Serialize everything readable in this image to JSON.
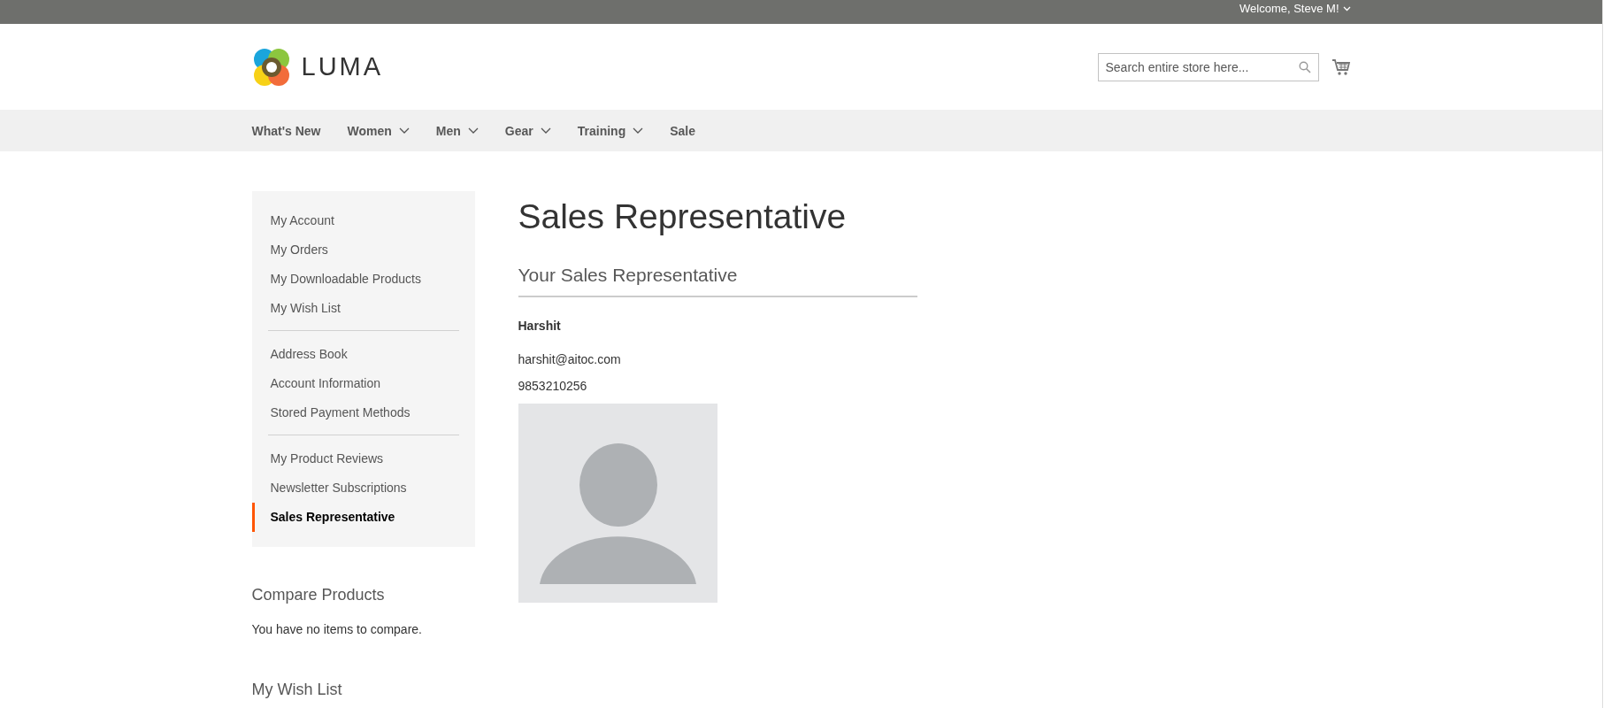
{
  "top_bar": {
    "welcome": "Welcome, Steve M!"
  },
  "header": {
    "logo_text": "LUMA",
    "search": {
      "placeholder": "Search entire store here..."
    }
  },
  "nav": [
    {
      "label": "What's New",
      "kind": "link"
    },
    {
      "label": "Women",
      "kind": "dropdown"
    },
    {
      "label": "Men",
      "kind": "dropdown"
    },
    {
      "label": "Gear",
      "kind": "dropdown"
    },
    {
      "label": "Training",
      "kind": "dropdown"
    },
    {
      "label": "Sale",
      "kind": "link"
    }
  ],
  "sidebar": {
    "groups": [
      [
        {
          "label": "My Account",
          "selected": false
        },
        {
          "label": "My Orders",
          "selected": false
        },
        {
          "label": "My Downloadable Products",
          "selected": false
        },
        {
          "label": "My Wish List",
          "selected": false
        }
      ],
      [
        {
          "label": "Address Book",
          "selected": false
        },
        {
          "label": "Account Information",
          "selected": false
        },
        {
          "label": "Stored Payment Methods",
          "selected": false
        }
      ],
      [
        {
          "label": "My Product Reviews",
          "selected": false
        },
        {
          "label": "Newsletter Subscriptions",
          "selected": false
        },
        {
          "label": "Sales Representative",
          "selected": true
        }
      ]
    ],
    "compare": {
      "title": "Compare Products",
      "text": "You have no items to compare."
    },
    "wishlist": {
      "title": "My Wish List"
    }
  },
  "main": {
    "title": "Sales Representative",
    "section_title": "Your Sales Representative",
    "name": "Harshit",
    "email": "harshit@aitoc.com",
    "phone": "9853210256"
  }
}
